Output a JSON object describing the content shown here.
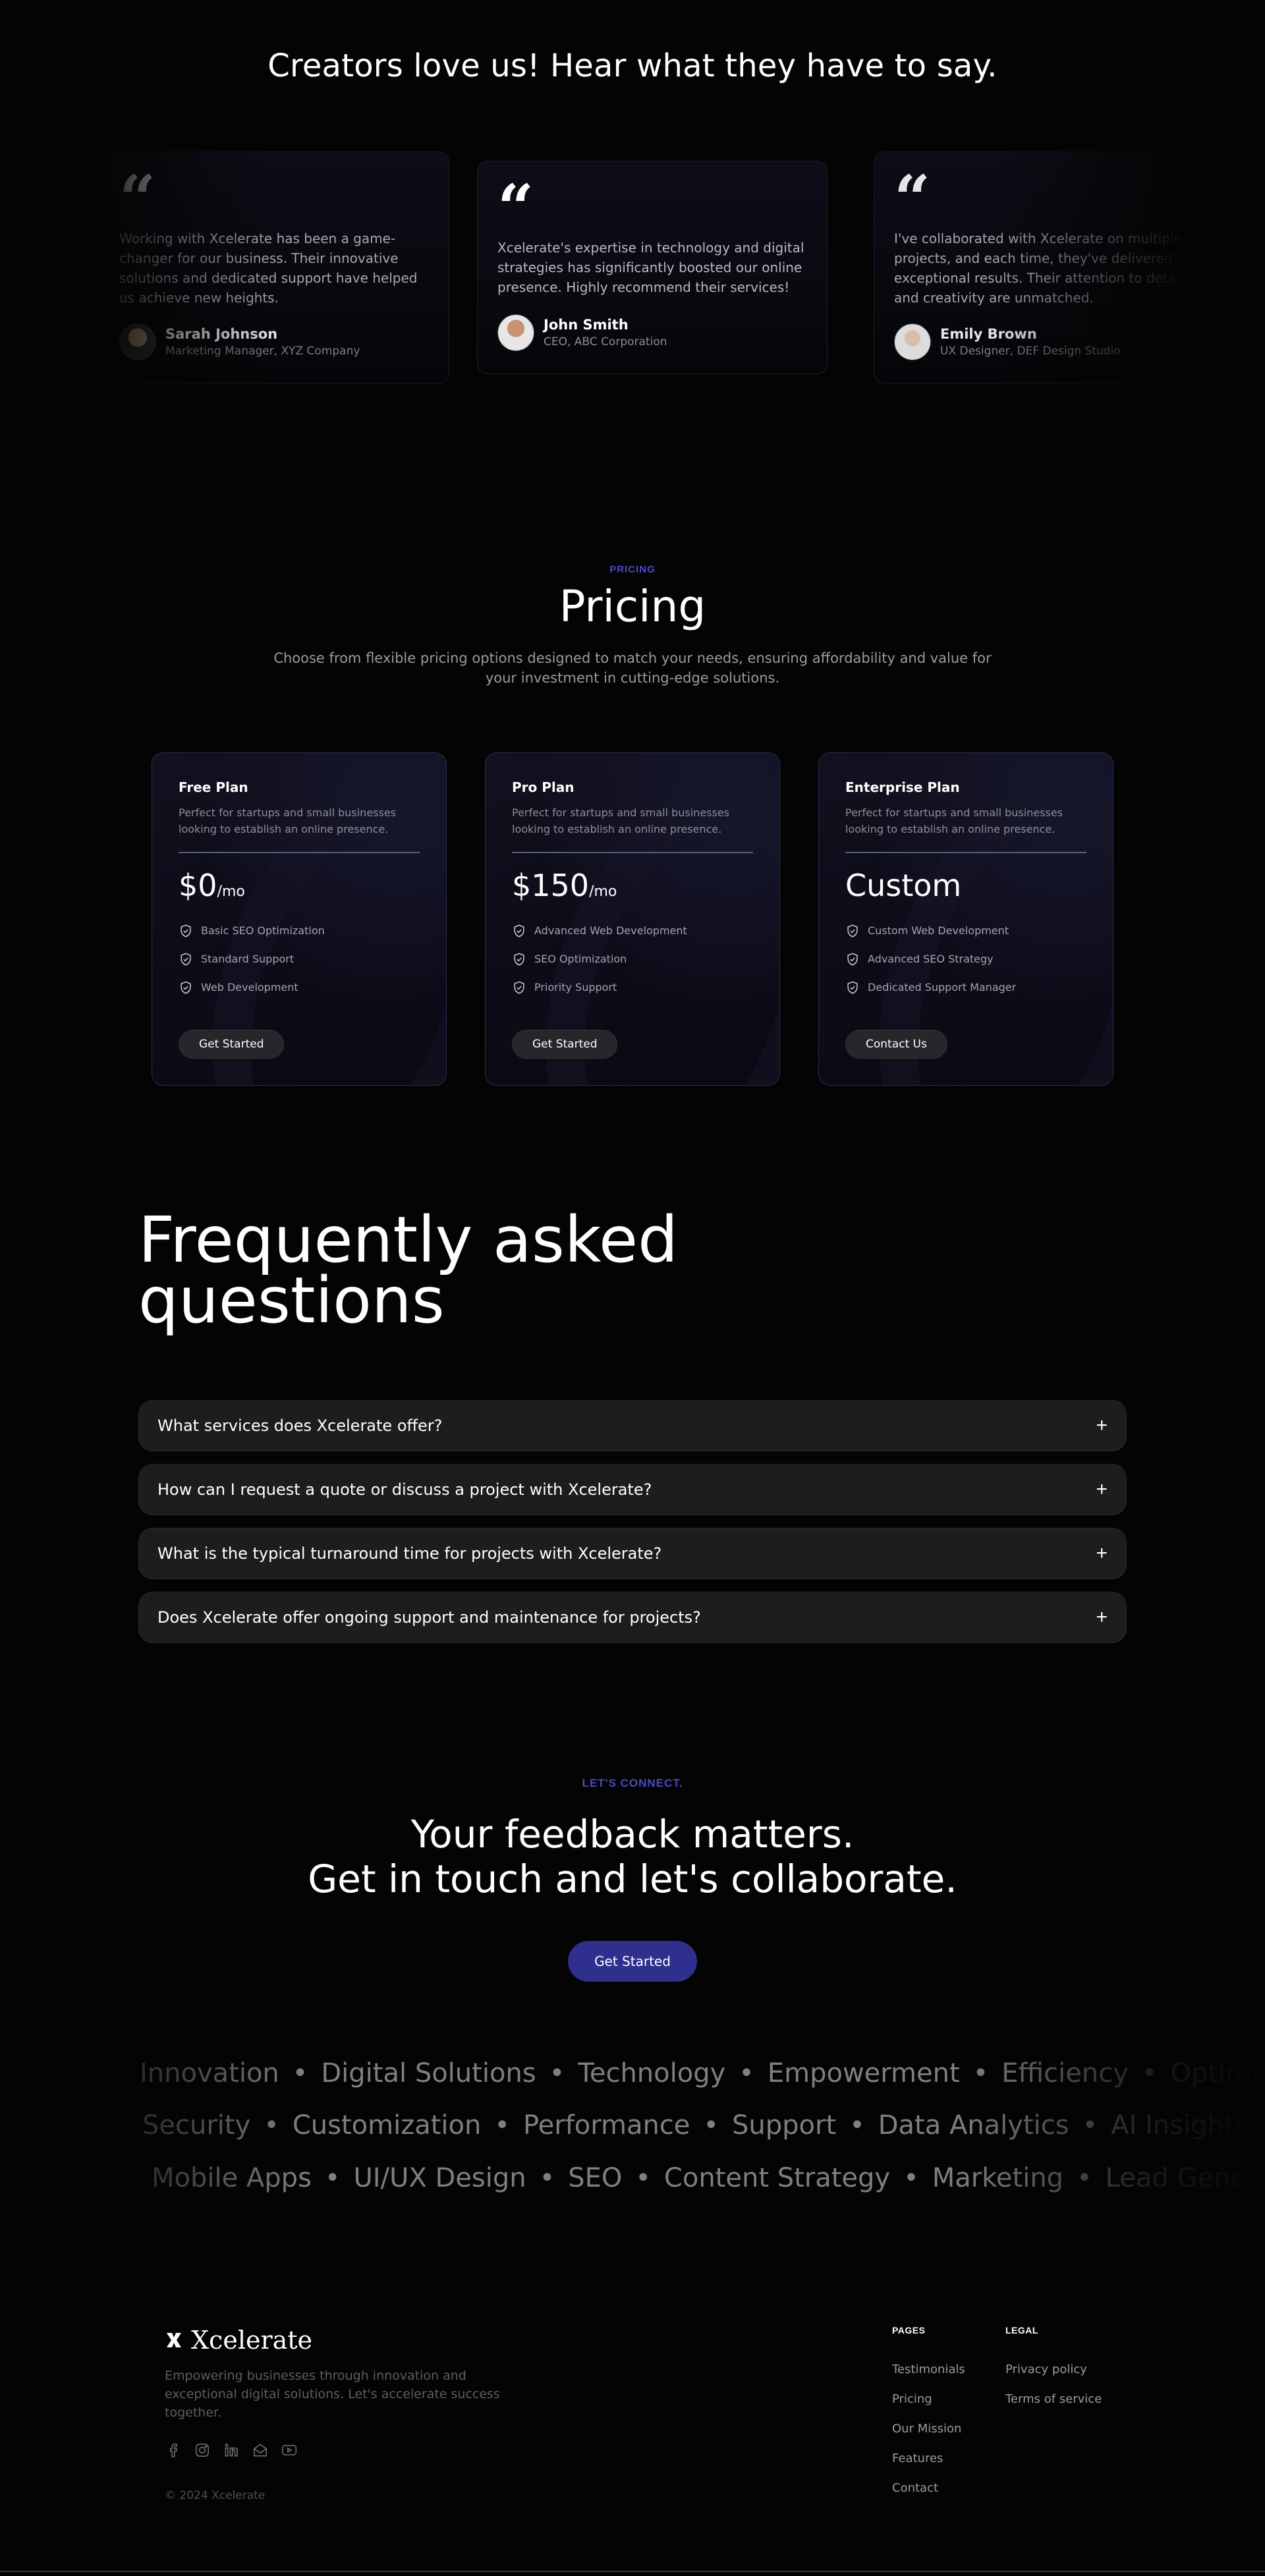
{
  "testimonials": {
    "title": "Creators love us! Hear what they have to say.",
    "items": [
      {
        "quote_mark": "“",
        "text": "Working with Xcelerate has been a game-changer for our business. Their innovative solutions and dedicated support have helped us achieve new heights.",
        "name": "Sarah Johnson",
        "role": "Marketing Manager, XYZ Company"
      },
      {
        "quote_mark": "“",
        "text": "Xcelerate's expertise in technology and digital strategies has significantly boosted our online presence. Highly recommend their services!",
        "name": "John Smith",
        "role": "CEO, ABC Corporation"
      },
      {
        "quote_mark": "“",
        "text": "I've collaborated with Xcelerate on multiple projects, and each time, they've delivered exceptional results. Their attention to detail and creativity are unmatched.",
        "name": "Emily Brown",
        "role": "UX Designer, DEF Design Studio"
      }
    ]
  },
  "pricing": {
    "eyebrow": "PRICING",
    "title": "Pricing",
    "subtitle": "Choose from flexible pricing options designed to match your needs, ensuring affordability and value for your investment in cutting-edge solutions.",
    "plans": [
      {
        "name": "Free Plan",
        "desc": "Perfect for startups and small businesses looking to establish an online presence.",
        "price": "$0",
        "per": "/mo",
        "features": [
          "Basic SEO Optimization",
          "Standard Support",
          "Web Development"
        ],
        "button": "Get Started"
      },
      {
        "name": "Pro Plan",
        "desc": "Perfect for startups and small businesses looking to establish an online presence.",
        "price": "$150",
        "per": "/mo",
        "features": [
          "Advanced Web Development",
          "SEO Optimization",
          "Priority Support"
        ],
        "button": "Get Started"
      },
      {
        "name": "Enterprise Plan",
        "desc": "Perfect for startups and small businesses looking to establish an online presence.",
        "price": "Custom",
        "per": "",
        "features": [
          "Custom Web Development",
          "Advanced SEO Strategy",
          "Dedicated Support Manager"
        ],
        "button": "Contact Us"
      }
    ]
  },
  "faq": {
    "title_line1": "Frequently asked",
    "title_line2": "questions",
    "expand_symbol": "+",
    "items": [
      "What services does Xcelerate offer?",
      "How can I request a quote or discuss a project with Xcelerate?",
      "What is the typical turnaround time for projects with Xcelerate?",
      "Does Xcelerate offer ongoing support and maintenance for projects?"
    ]
  },
  "cta": {
    "eyebrow": "LET'S CONNECT.",
    "title_line1": "Your feedback matters.",
    "title_line2": "Get in touch and let's collaborate.",
    "button": "Get Started"
  },
  "marquee": {
    "separator": "•",
    "rows": [
      [
        "Innovation",
        "Digital Solutions",
        "Technology",
        "Empowerment",
        "Efficiency",
        "Optimization"
      ],
      [
        "Security",
        "Customization",
        "Performance",
        "Support",
        "Data Analytics",
        "AI Insights"
      ],
      [
        "Mobile Apps",
        "UI/UX Design",
        "SEO",
        "Content Strategy",
        "Marketing",
        "Lead Generation"
      ]
    ]
  },
  "footer": {
    "brand": "Xcelerate",
    "description": "Empowering businesses through innovation and exceptional digital solutions. Let's accelerate success together.",
    "social_icons": [
      "facebook-icon",
      "instagram-icon",
      "linkedin-icon",
      "mail-icon",
      "youtube-icon"
    ],
    "copyright": "© 2024 Xcelerate",
    "pages_heading": "PAGES",
    "pages": [
      "Testimonials",
      "Pricing",
      "Our Mission",
      "Features",
      "Contact"
    ],
    "legal_heading": "LEGAL",
    "legal": [
      "Privacy policy",
      "Terms of service"
    ]
  },
  "colors": {
    "background": "#040404",
    "accent": "#2f2f8e",
    "eyebrow": "#4b4bc8"
  }
}
